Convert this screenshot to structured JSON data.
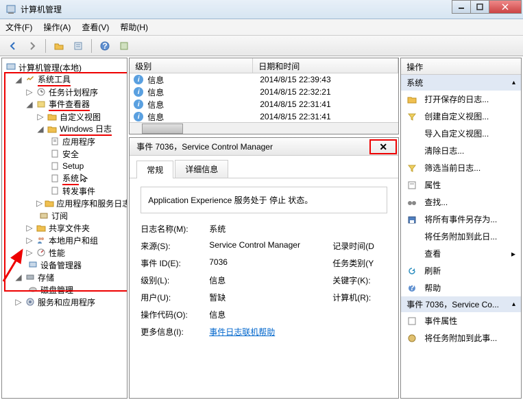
{
  "titlebar": {
    "title": "计算机管理"
  },
  "menu": {
    "file": "文件(F)",
    "action": "操作(A)",
    "view": "查看(V)",
    "help": "帮助(H)"
  },
  "tree": {
    "root": "计算机管理(本地)",
    "sys_tools": "系统工具",
    "task_scheduler": "任务计划程序",
    "event_viewer": "事件查看器",
    "custom_views": "自定义视图",
    "windows_logs": "Windows 日志",
    "app_log": "应用程序",
    "security": "安全",
    "setup": "Setup",
    "system": "系统",
    "forwarded": "转发事件",
    "apps_services_logs": "应用程序和服务日志",
    "subscriptions": "订阅",
    "shared_folders": "共享文件夹",
    "local_users": "本地用户和组",
    "performance": "性能",
    "device_manager": "设备管理器",
    "storage": "存储",
    "disk_mgmt": "磁盘管理",
    "services_apps": "服务和应用程序"
  },
  "event_list": {
    "col_level": "级别",
    "col_date": "日期和时间",
    "rows": [
      {
        "level": "信息",
        "date": "2014/8/15 22:39:43"
      },
      {
        "level": "信息",
        "date": "2014/8/15 22:32:21"
      },
      {
        "level": "信息",
        "date": "2014/8/15 22:31:41"
      },
      {
        "level": "信息",
        "date": "2014/8/15 22:31:41"
      }
    ]
  },
  "detail": {
    "title": "事件 7036，Service Control Manager",
    "tab_general": "常规",
    "tab_details": "详细信息",
    "message": "Application Experience 服务处于 停止 状态。",
    "labels": {
      "log_name": "日志名称(M):",
      "source": "来源(S):",
      "event_id": "事件 ID(E):",
      "level": "级别(L):",
      "user": "用户(U):",
      "opcode": "操作代码(O):",
      "more": "更多信息(I):",
      "logged": "记录时间(D",
      "category": "任务类别(Y",
      "keywords": "关键字(K):",
      "computer": "计算机(R):"
    },
    "values": {
      "log_name": "系统",
      "source": "Service Control Manager",
      "event_id": "7036",
      "level": "信息",
      "user": "暂缺",
      "opcode": "信息",
      "more_link": "事件日志联机帮助"
    }
  },
  "actions": {
    "header": "操作",
    "group1": "系统",
    "open_saved": "打开保存的日志...",
    "create_custom": "创建自定义视图...",
    "import_custom": "导入自定义视图...",
    "clear_log": "清除日志...",
    "filter_current": "筛选当前日志...",
    "properties": "属性",
    "find": "查找...",
    "save_all": "将所有事件另存为...",
    "attach_task": "将任务附加到此日...",
    "view": "查看",
    "refresh": "刷新",
    "help": "帮助",
    "group2": "事件 7036，Service Co...",
    "event_props": "事件属性",
    "attach_event": "将任务附加到此事..."
  }
}
